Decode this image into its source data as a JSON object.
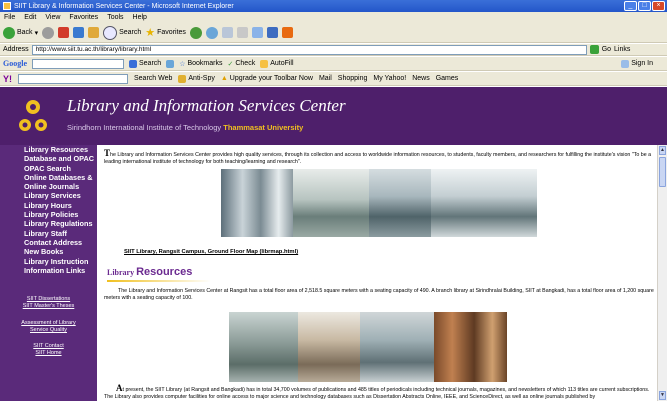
{
  "window": {
    "title": "SIIT Library & Information Services Center - Microsoft Internet Explorer"
  },
  "menu": [
    "File",
    "Edit",
    "View",
    "Favorites",
    "Tools",
    "Help"
  ],
  "toolbar": {
    "back": "Back",
    "search": "Search",
    "favorites": "Favorites"
  },
  "address": {
    "label": "Address",
    "url": "http://www.siit.tu.ac.th/library/library.html",
    "go": "Go",
    "links": "Links"
  },
  "google_bar": {
    "brand": "Google",
    "search": "Search",
    "bookmarks": "Bookmarks",
    "check": "Check",
    "autofill": "AutoFill",
    "signin": "Sign In"
  },
  "yahoo_bar": {
    "search_web": "Search Web",
    "antispy": "Anti-Spy",
    "upgrade": "Upgrade your Toolbar Now",
    "mail": "Mail",
    "shopping": "Shopping",
    "my_yahoo": "My Yahoo!",
    "news": "News",
    "games": "Games"
  },
  "header": {
    "title": "Library and Information Services Center",
    "subtitle": "Sirindhorn International Institute of Technology",
    "university": "Thammasat University"
  },
  "sidebar": {
    "items": [
      "Library Resources",
      "Database and OPAC",
      "OPAC Search",
      "Online Databases &",
      "Online Journals",
      "Library Services",
      "Library Hours",
      "Library Policies",
      "Library Regulations",
      "Library Staff",
      "Contact Address",
      "New Books",
      "Library Instruction",
      "Information Links"
    ],
    "links1": [
      "SIIT Dissertations",
      "SIIT Master's Theses"
    ],
    "links2": [
      "Assessment of Library",
      "Service Quality"
    ],
    "links3": [
      "SIIT Contact",
      "SIIT Home"
    ]
  },
  "content": {
    "intro_drop": "T",
    "intro": "he Library and Information Services Center provides high quality services, through its collection and access to worldwide information resources, to students, faculty members, and researchers for fulfilling the institute's vision \"To be a leading international institute of technology for both teaching/learning and research\".",
    "map_link": "SIIT Library, Rangsit Campus, Ground Floor Map (librmap.html)",
    "resources_small": "Library",
    "resources_big": "Resources",
    "resources_para": "The Library and Information Services Center at Rangsit has a total floor area of 2,518.5 square meters with a seating capacity of 490. A branch library at Sirindhralai Building, SIIT at Bangkadi, has a total floor area of 1,200 square meters with a seating capacity of 100.",
    "present_drop": "A",
    "present_para": "t present, the SIIT Library (at Rangsit and Bangkadi) has in total 34,700 volumes of publications and 485 titles of periodicals including technical journals, magazines, and newsletters of which 113 titles are current subscriptions. The Library also provides computer facilities for online access to major science and technology databases such as Dissertation Abstracts Online, IEEE, and ScienceDirect, as well as online journals published by"
  }
}
